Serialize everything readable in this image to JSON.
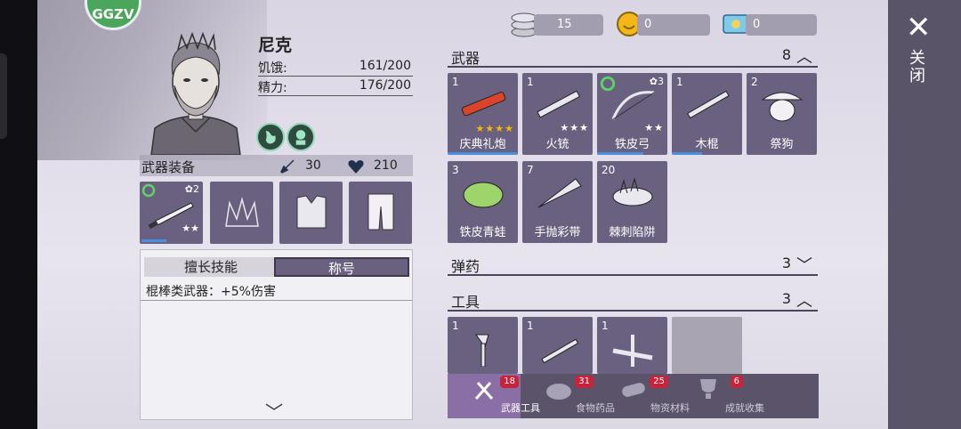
{
  "header": {
    "level_badge": "GGZV"
  },
  "character": {
    "name": "尼克",
    "hunger_label": "饥饿:",
    "hunger_value": "161/200",
    "energy_label": "精力:",
    "energy_value": "176/200"
  },
  "equipment": {
    "title": "武器装备",
    "attack": "30",
    "health": "210",
    "slots": [
      {
        "name": "weapon",
        "level": "2",
        "stars": "★★"
      },
      {
        "name": "headgear"
      },
      {
        "name": "top"
      },
      {
        "name": "pants"
      }
    ]
  },
  "skills_panel": {
    "tab_skill": "擅长技能",
    "tab_title": "称号",
    "description": "棍棒类武器：+5%伤害"
  },
  "currency": [
    {
      "icon": "coin-stack-icon",
      "value": "15"
    },
    {
      "icon": "smiley-coin-icon",
      "value": "0"
    },
    {
      "icon": "ticket-icon",
      "value": "0"
    }
  ],
  "sections": {
    "weapons": {
      "title": "武器",
      "count": "8"
    },
    "ammo": {
      "title": "弹药",
      "count": "3"
    },
    "tools": {
      "title": "工具",
      "count": "3"
    }
  },
  "weapons": [
    {
      "qty": "1",
      "name": "庆典礼炮",
      "stars": "★★★★"
    },
    {
      "qty": "1",
      "name": "火铳",
      "stars": "★★★"
    },
    {
      "qty": "",
      "name": "铁皮弓",
      "stars": "★★",
      "level": "3"
    },
    {
      "qty": "1",
      "name": "木棍",
      "stars": ""
    },
    {
      "qty": "2",
      "name": "祭狗",
      "stars": ""
    },
    {
      "qty": "3",
      "name": "铁皮青蛙",
      "stars": ""
    },
    {
      "qty": "7",
      "name": "手抛彩带",
      "stars": ""
    },
    {
      "qty": "20",
      "name": "棘刺陷阱",
      "stars": ""
    }
  ],
  "tools": [
    {
      "qty": "1"
    },
    {
      "qty": "1"
    },
    {
      "qty": "1"
    }
  ],
  "bottom_tabs": [
    {
      "label": "武器工具",
      "badge": "18"
    },
    {
      "label": "食物药品",
      "badge": "31"
    },
    {
      "label": "物资材料",
      "badge": "25"
    },
    {
      "label": "成就收集",
      "badge": "6"
    }
  ],
  "close": {
    "label": "关闭"
  }
}
